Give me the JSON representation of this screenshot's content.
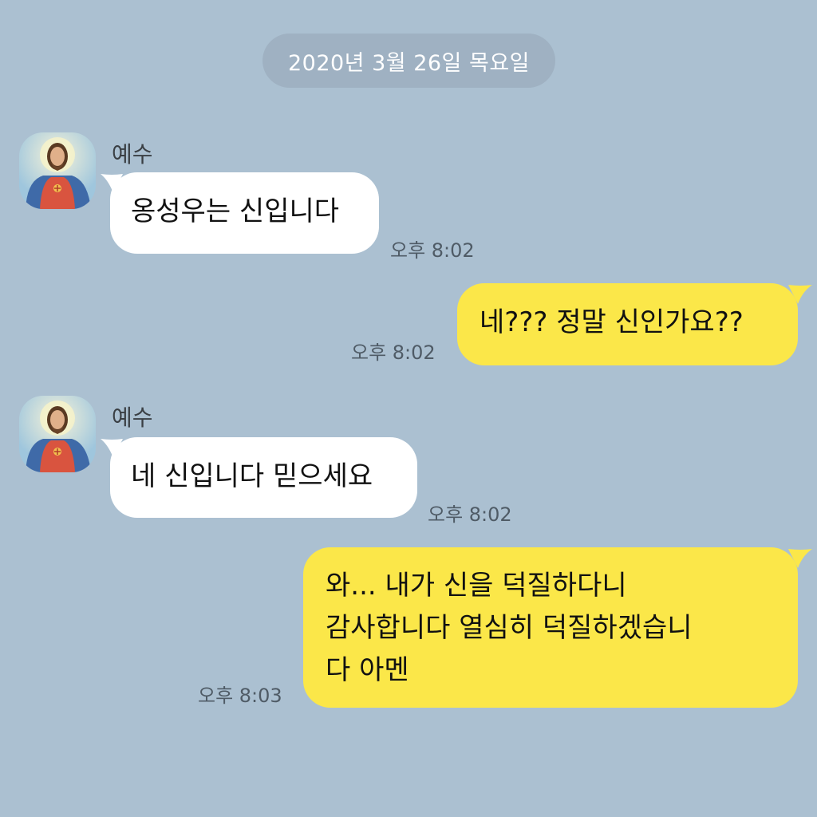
{
  "date_divider": "2020년 3월 26일 목요일",
  "colors": {
    "background": "#abc0d1",
    "incoming_bubble": "#ffffff",
    "outgoing_bubble": "#fbe749",
    "date_pill": "#9fb1c2"
  },
  "messages": [
    {
      "direction": "incoming",
      "sender": "예수",
      "avatar": "jesus-avatar",
      "text": "옹성우는 신입니다",
      "time": "오후 8:02"
    },
    {
      "direction": "outgoing",
      "text": "네??? 정말 신인가요??",
      "time": "오후 8:02"
    },
    {
      "direction": "incoming",
      "sender": "예수",
      "avatar": "jesus-avatar",
      "text": "네 신입니다 믿으세요",
      "time": "오후 8:02"
    },
    {
      "direction": "outgoing",
      "lines": [
        "와... 내가 신을 덕질하다니",
        "감사합니다 열심히 덕질하겠습니",
        "다 아멘"
      ],
      "time": "오후 8:03"
    }
  ]
}
